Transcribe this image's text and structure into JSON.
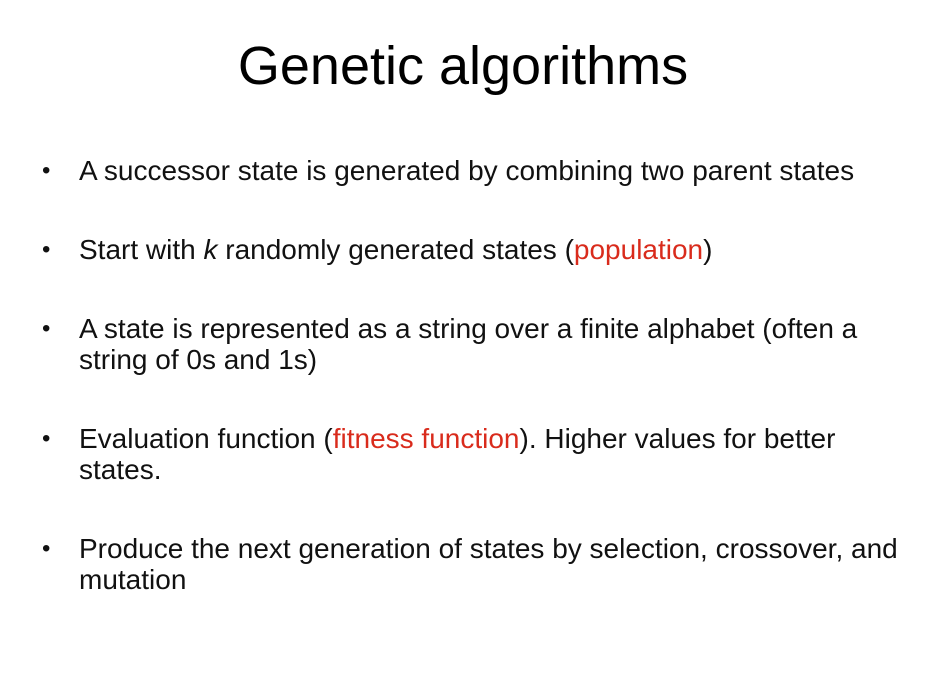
{
  "slide": {
    "title": "Genetic algorithms",
    "accent_color": "#d92b1c",
    "bullet_glyph": "•",
    "bullets": [
      {
        "text": "A successor state is generated by combining two parent states"
      },
      {
        "pre": "Start with ",
        "italic": "k",
        "mid": " randomly generated states (",
        "highlight": "population",
        "post": ")"
      },
      {
        "text": "A state is represented as a string over a finite alphabet (often a string of 0s and 1s)"
      },
      {
        "pre": "Evaluation function (",
        "highlight": "fitness function",
        "post": "). Higher values for better states."
      },
      {
        "text": "Produce the next generation of states by selection, crossover, and mutation"
      }
    ]
  }
}
